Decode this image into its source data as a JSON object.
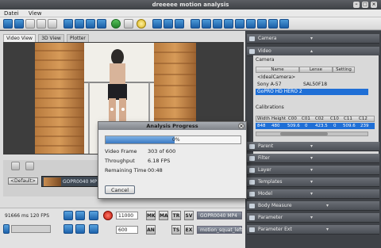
{
  "window": {
    "title": "dreeeee motion analysis"
  },
  "menu": [
    "Datei",
    "View"
  ],
  "left": {
    "tabs": [
      "Video View",
      "3D View",
      "Plotter"
    ],
    "default_label": "<Default>",
    "clip_label": "GOPR0040 MP"
  },
  "bottom": {
    "time_readout": "91666 ms  120 FPS",
    "frame_field": "11000",
    "step_field": "600",
    "btn_mk": "MK",
    "btn_ma": "MA",
    "btn_tr": "TR",
    "btn_sv": "SV",
    "btn_an": "AN",
    "btn_ts": "TS",
    "btn_ex": "EX",
    "video_dropdown": "GOPR0040 MP4",
    "marker_dropdown": "motion_squat_left"
  },
  "right": {
    "headers": [
      "Camera",
      "Video",
      "Parent",
      "Filter",
      "Layer",
      "Templates",
      "Model",
      "Body Measure",
      "Parameter",
      "Parameter Ext"
    ],
    "camera_label": "Camera",
    "camera_columns": [
      "Name",
      "Lense",
      "Setting"
    ],
    "camera_rows": [
      {
        "name": "<IdealCamera>",
        "lense": "",
        "setting": ""
      },
      {
        "name": "Sony A-57",
        "lense": "SAL50F18",
        "setting": ""
      },
      {
        "name": "GoPRO HD HERO 2",
        "lense": "",
        "setting": ""
      }
    ],
    "calibrations_label": "Calibrations",
    "calib_columns": [
      "Width",
      "Height",
      "C00",
      "C01",
      "C02",
      "C10",
      "C11",
      "C12"
    ],
    "calib_row": [
      "848",
      "480",
      "509.6",
      "0",
      "423.5",
      "0",
      "509.6",
      "239"
    ]
  },
  "dialog": {
    "title": "Analysis Progress",
    "progress_percent": 51,
    "progress_text": "0%",
    "rows": [
      {
        "label": "Video Frame",
        "value": "303 of 600"
      },
      {
        "label": "Throughput",
        "value": "6.18 FPS"
      },
      {
        "label": "Remaining Time",
        "value": "00:48"
      }
    ],
    "cancel_label": "Cancel"
  }
}
